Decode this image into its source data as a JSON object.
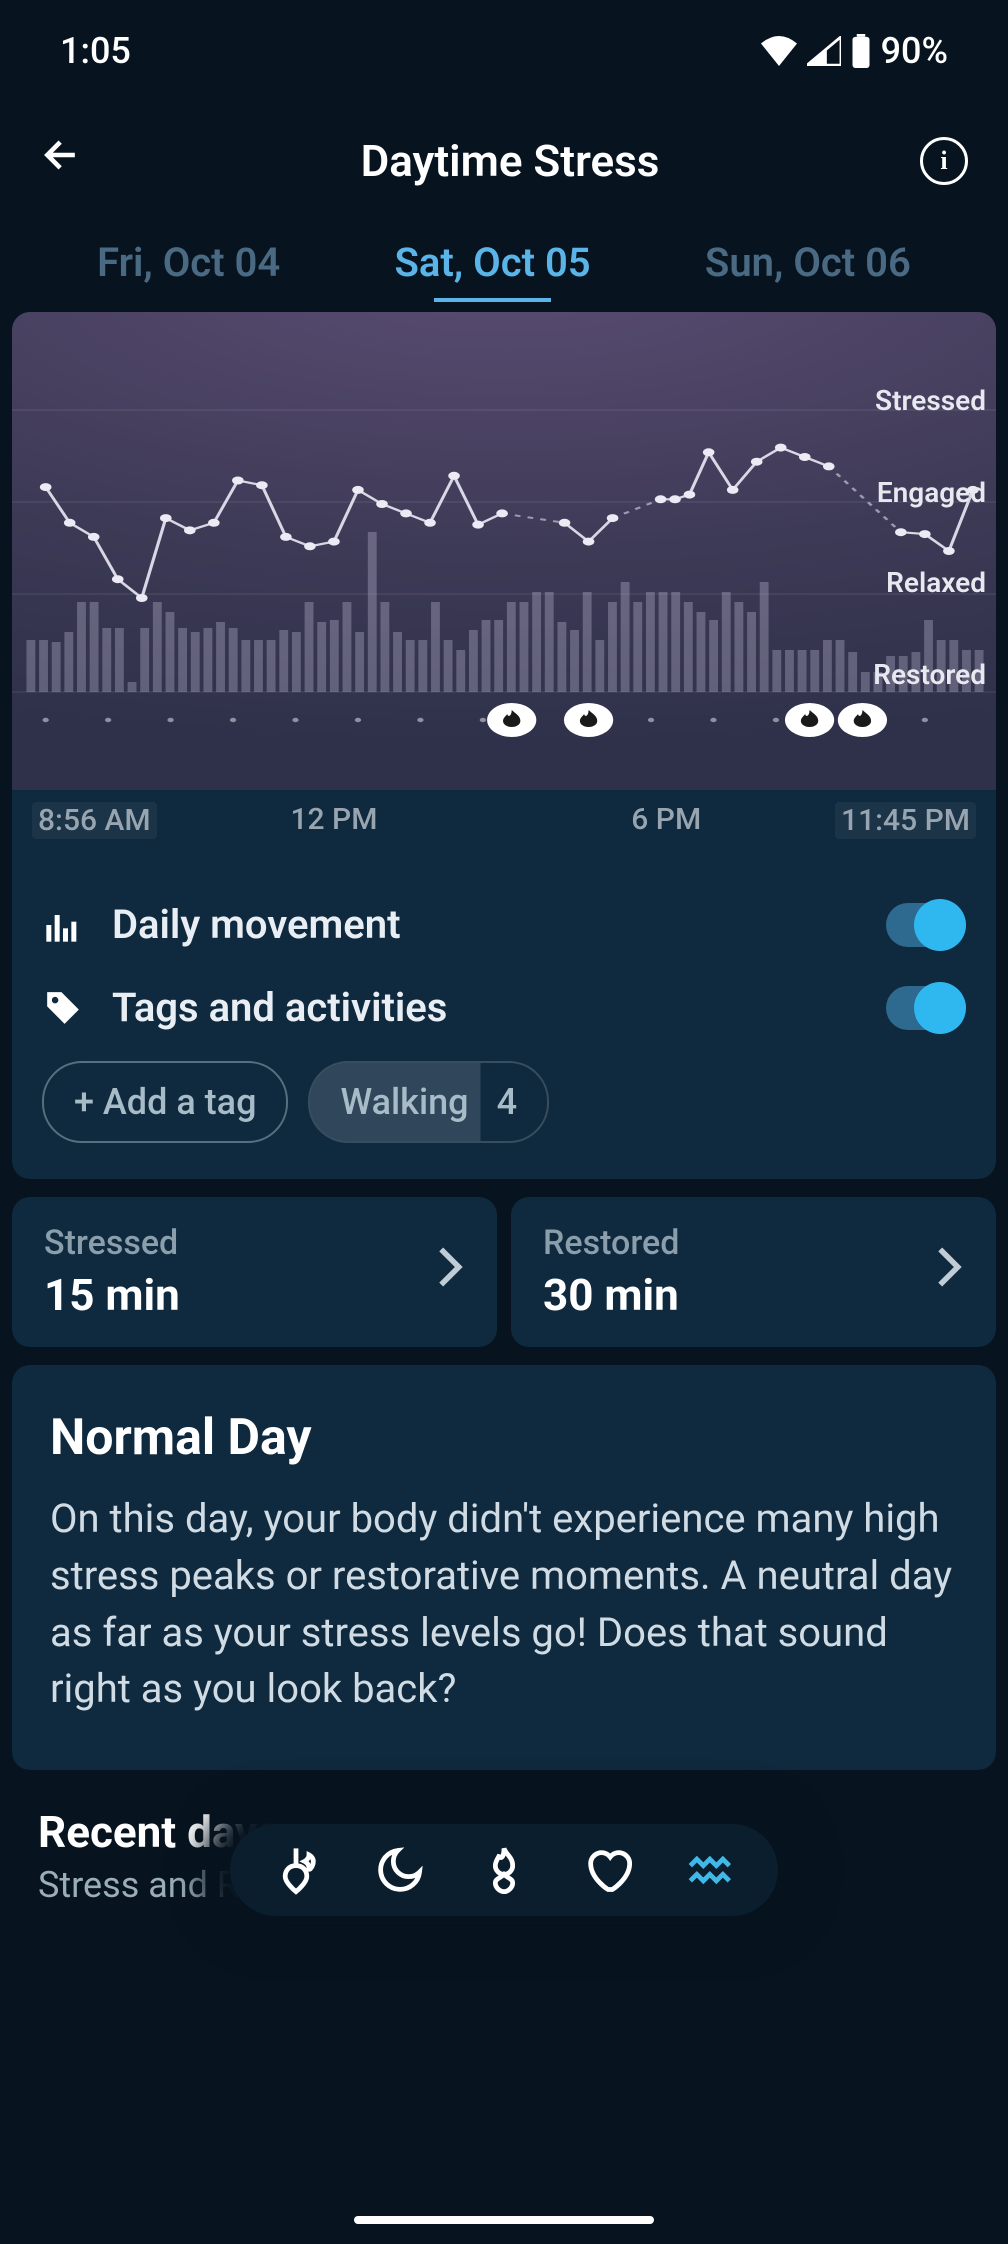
{
  "status_bar": {
    "time": "1:05",
    "battery": "90%"
  },
  "header": {
    "title": "Daytime Stress"
  },
  "tabs": {
    "prev": "Fri, Oct 04",
    "current": "Sat, Oct 05",
    "next": "Sun, Oct 06"
  },
  "chart_data": {
    "type": "line",
    "ylabels": [
      "Stressed",
      "Engaged",
      "Relaxed",
      "Restored"
    ],
    "xticks": [
      "8:56 AM",
      "12 PM",
      "6 PM",
      "11:45 PM"
    ],
    "x_start": "8:56 AM",
    "x_end": "11:45 PM",
    "bars_movement": [
      52,
      52,
      50,
      60,
      90,
      90,
      64,
      64,
      10,
      64,
      90,
      80,
      64,
      60,
      64,
      70,
      64,
      52,
      52,
      52,
      62,
      60,
      90,
      70,
      72,
      90,
      60,
      160,
      90,
      60,
      52,
      52,
      90,
      52,
      42,
      62,
      72,
      72,
      90,
      90,
      100,
      100,
      70,
      62,
      100,
      52,
      90,
      110,
      90,
      100,
      100,
      100,
      90,
      80,
      72,
      100,
      90,
      80,
      110,
      42,
      42,
      42,
      42,
      52,
      52,
      40,
      20,
      20,
      36,
      36,
      40,
      72,
      52,
      52,
      42,
      42
    ],
    "stress_series": [
      {
        "x": 0.02,
        "y": 2.18
      },
      {
        "x": 0.045,
        "y": 1.8
      },
      {
        "x": 0.07,
        "y": 1.65
      },
      {
        "x": 0.095,
        "y": 1.2
      },
      {
        "x": 0.12,
        "y": 1.0
      },
      {
        "x": 0.145,
        "y": 1.85
      },
      {
        "x": 0.17,
        "y": 1.72
      },
      {
        "x": 0.195,
        "y": 1.8
      },
      {
        "x": 0.22,
        "y": 2.25
      },
      {
        "x": 0.245,
        "y": 2.2
      },
      {
        "x": 0.27,
        "y": 1.65
      },
      {
        "x": 0.295,
        "y": 1.55
      },
      {
        "x": 0.32,
        "y": 1.6
      },
      {
        "x": 0.345,
        "y": 2.15
      },
      {
        "x": 0.37,
        "y": 2.0
      },
      {
        "x": 0.395,
        "y": 1.9
      },
      {
        "x": 0.42,
        "y": 1.8
      },
      {
        "x": 0.445,
        "y": 2.3
      },
      {
        "x": 0.47,
        "y": 1.78
      },
      {
        "x": 0.495,
        "y": 1.9
      },
      {
        "x": 0.56,
        "y": 1.8
      },
      {
        "x": 0.585,
        "y": 1.6
      },
      {
        "x": 0.61,
        "y": 1.85
      },
      {
        "x": 0.66,
        "y": 2.05
      },
      {
        "x": 0.675,
        "y": 2.05
      },
      {
        "x": 0.69,
        "y": 2.1
      },
      {
        "x": 0.71,
        "y": 2.55
      },
      {
        "x": 0.735,
        "y": 2.15
      },
      {
        "x": 0.76,
        "y": 2.45
      },
      {
        "x": 0.785,
        "y": 2.6
      },
      {
        "x": 0.81,
        "y": 2.5
      },
      {
        "x": 0.835,
        "y": 2.4
      },
      {
        "x": 0.91,
        "y": 1.7
      },
      {
        "x": 0.935,
        "y": 1.68
      },
      {
        "x": 0.96,
        "y": 1.5
      },
      {
        "x": 0.985,
        "y": 2.15
      }
    ],
    "gaps_after_index": [
      19,
      22,
      31
    ],
    "flame_markers_x": [
      0.505,
      0.585,
      0.815,
      0.87
    ],
    "dot_markers_x": [
      0.02,
      0.085,
      0.15,
      0.215,
      0.28,
      0.345,
      0.41,
      0.475,
      0.65,
      0.715,
      0.78,
      0.935
    ]
  },
  "controls": {
    "movement_label": "Daily movement",
    "movement_on": true,
    "tags_label": "Tags and activities",
    "tags_on": true,
    "add_tag_label": "+ Add a tag",
    "activity_tag": {
      "name": "Walking",
      "count": "4"
    }
  },
  "stats": {
    "stressed_label": "Stressed",
    "stressed_value": "15 min",
    "restored_label": "Restored",
    "restored_value": "30 min"
  },
  "summary": {
    "title": "Normal Day",
    "body": "On this day, your body didn't experience many high stress peaks or restorative moments. A neutral day as far as your stress levels go! Does that sound right as you look back?"
  },
  "recent": {
    "title": "Recent days",
    "subtitle": "Stress and Restorative Time"
  }
}
